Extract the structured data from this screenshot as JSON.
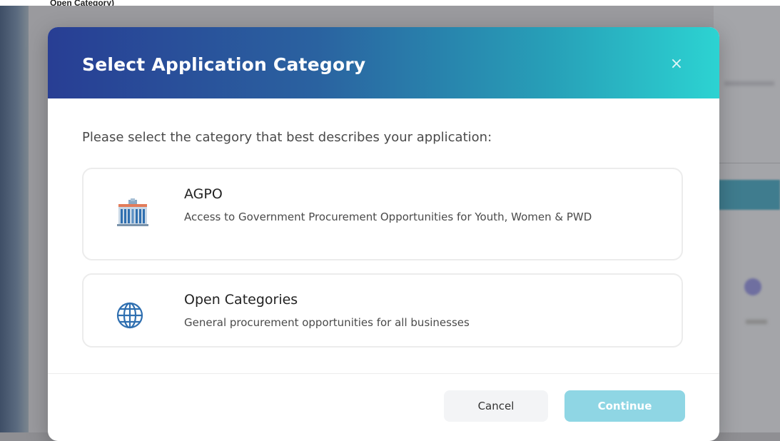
{
  "background": {
    "top_text": "Open Category)"
  },
  "modal": {
    "title": "Select Application Category",
    "close_symbol": "×",
    "prompt": "Please select the category that best describes your application:",
    "options": [
      {
        "title": "AGPO",
        "description": "Access to Government Procurement Opportunities for Youth, Women & PWD",
        "icon": "building-icon"
      },
      {
        "title": "Open Categories",
        "description": "General procurement opportunities for all businesses",
        "icon": "globe-icon"
      }
    ],
    "buttons": {
      "cancel": "Cancel",
      "continue": "Continue"
    }
  },
  "colors": {
    "header_gradient_start": "#283e94",
    "header_gradient_end": "#2cd3d2",
    "continue_button": "#8fd6e4",
    "icon_blue": "#2f6fb0"
  }
}
